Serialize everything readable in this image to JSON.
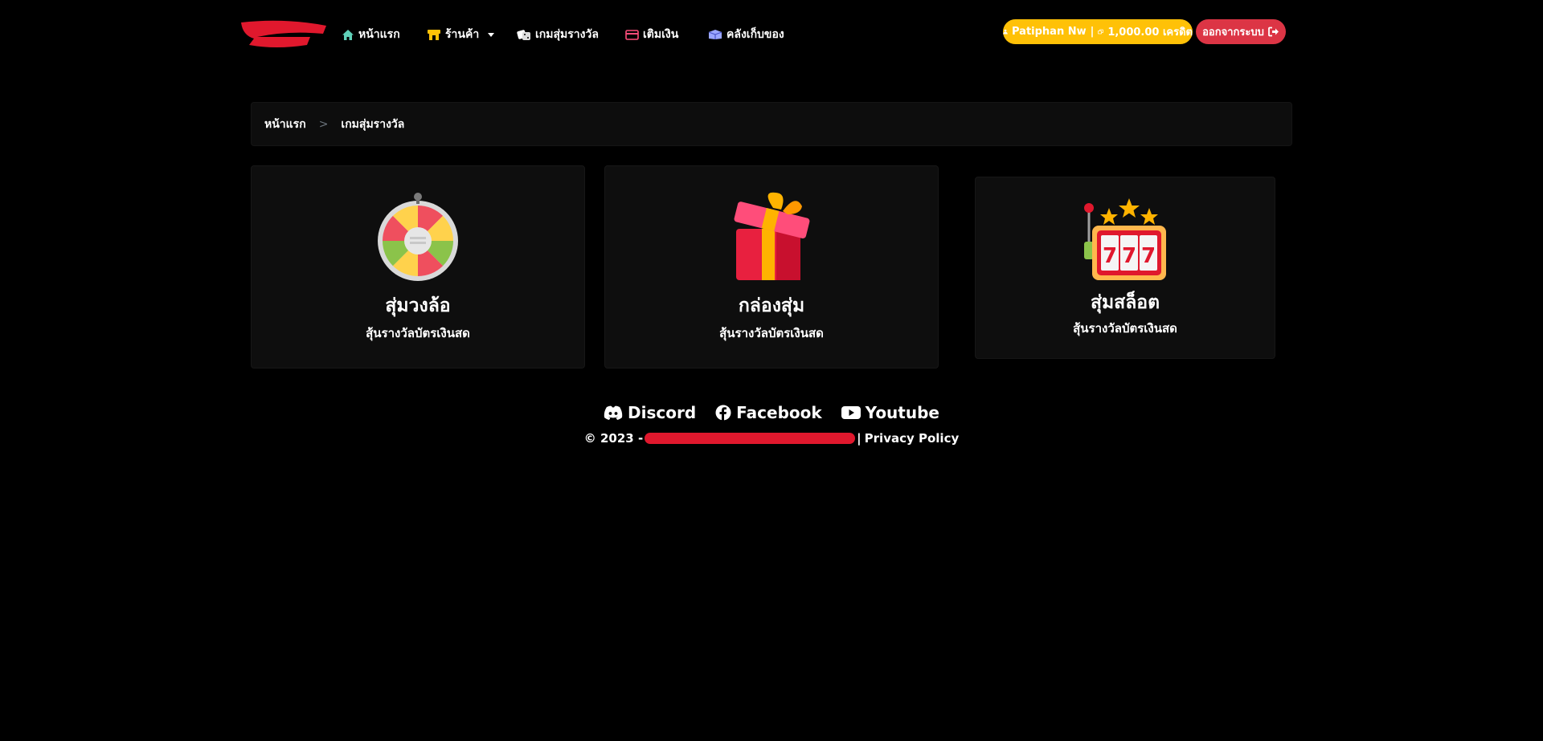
{
  "nav": {
    "home": "หน้าแรก",
    "shop": "ร้านค้า",
    "games": "เกมสุ่มรางวัล",
    "topup": "เติมเงิน",
    "inventory": "คลังเก็บของ"
  },
  "user": {
    "name": "Patiphan Nw",
    "separator": "|",
    "credits": "1,000.00 เครดิต"
  },
  "logout_label": "ออกจากระบบ",
  "breadcrumb": {
    "home": "หน้าแรก",
    "separator": ">",
    "current": "เกมสุ่มรางวัล"
  },
  "cards": [
    {
      "title": "สุ่มวงล้อ",
      "subtitle": "สุ้นรางวัลบัตรเงินสด",
      "icon": "prize-wheel-icon"
    },
    {
      "title": "กล่องสุ่ม",
      "subtitle": "สุ้นรางวัลบัตรเงินสด",
      "icon": "gift-box-icon"
    },
    {
      "title": "สุ่มสล็อต",
      "subtitle": "สุ้นรางวัลบัตรเงินสด",
      "icon": "slot-machine-777-icon"
    }
  ],
  "footer": {
    "socials": [
      "Discord",
      "Facebook",
      "Youtube"
    ],
    "copyright_prefix": "© 2023 -",
    "privacy_separator": "|",
    "privacy": "Privacy Policy"
  },
  "colors": {
    "background": "#000000",
    "card_bg": "#0e0e0e",
    "user_pill": "#ffc107",
    "logout": "#dc3545",
    "logo_redaction": "#e0182d"
  }
}
